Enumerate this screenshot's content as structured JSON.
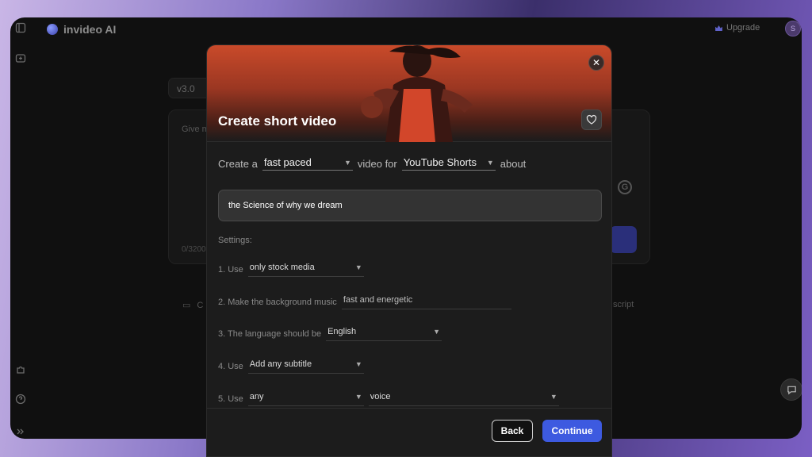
{
  "app": {
    "name": "invideo AI",
    "upgrade_label": "Upgrade",
    "avatar_initial": "S"
  },
  "background": {
    "version": "v3.0",
    "prompt_placeholder": "Give m",
    "char_counter": "0/3200",
    "bottom_left": "C",
    "bottom_right": "script",
    "g_badge": "G"
  },
  "modal": {
    "title": "Create short video",
    "close_glyph": "✕",
    "sentence": {
      "prefix": "Create a",
      "pace": "fast paced",
      "middle": "video for",
      "platform": "YouTube Shorts",
      "suffix": "about"
    },
    "topic": "the Science of why we dream",
    "settings_label": "Settings:",
    "settings": {
      "s1_label": "1. Use",
      "s1_value": "only stock media",
      "s2_label": "2. Make the background music",
      "s2_value": "fast and energetic",
      "s3_label": "3. The language should be",
      "s3_value": "English",
      "s4_label": "4. Use",
      "s4_value": "Add any subtitle",
      "s5_label": "5. Use",
      "s5_value_a": "any",
      "s5_value_b": "voice"
    },
    "back_label": "Back",
    "continue_label": "Continue"
  },
  "icons": {
    "chevron": "chevron-down-icon",
    "heart": "heart-icon",
    "close": "close-icon",
    "chat": "chat-icon"
  },
  "colors": {
    "accent": "#3d5ae0",
    "hero": "#c94a2a"
  }
}
